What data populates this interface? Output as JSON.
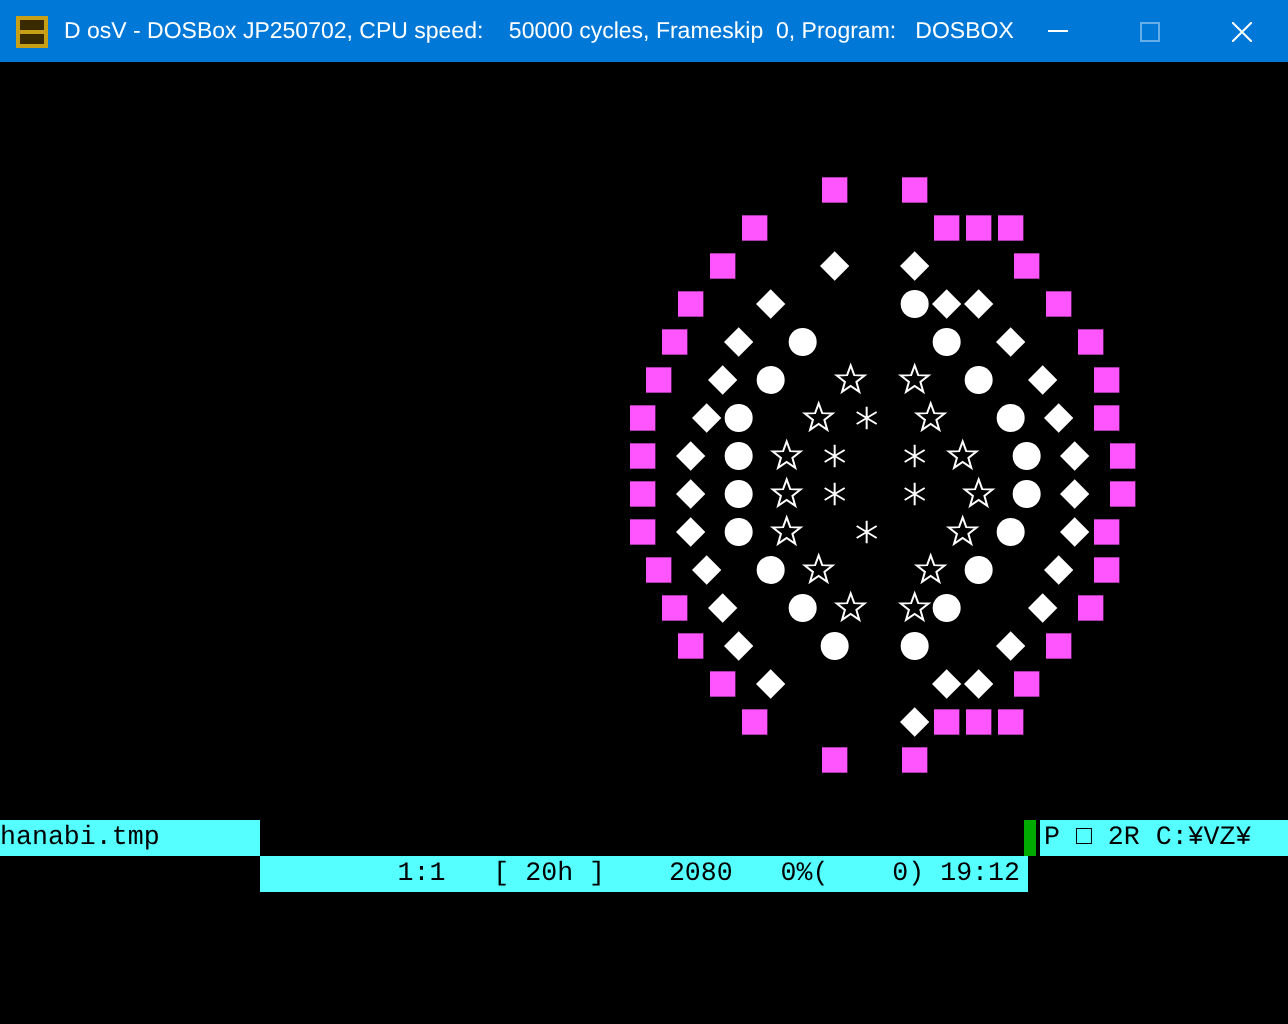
{
  "window": {
    "title": "D osV - DOSBox JP250702, CPU speed:    50000 cycles, Frameskip  0, Program:   DOSBOX",
    "controls": [
      {
        "kind": "minimize",
        "disabled": false
      },
      {
        "kind": "maximize",
        "disabled": true
      },
      {
        "kind": "close",
        "disabled": false
      }
    ]
  },
  "editor": {
    "filename": "hanabi.tmp",
    "mode_line": "P □ 2R C:¥VZ¥",
    "status_line": "1:1   [ 20h ]    2080   0%(    0) 19:12"
  }
}
